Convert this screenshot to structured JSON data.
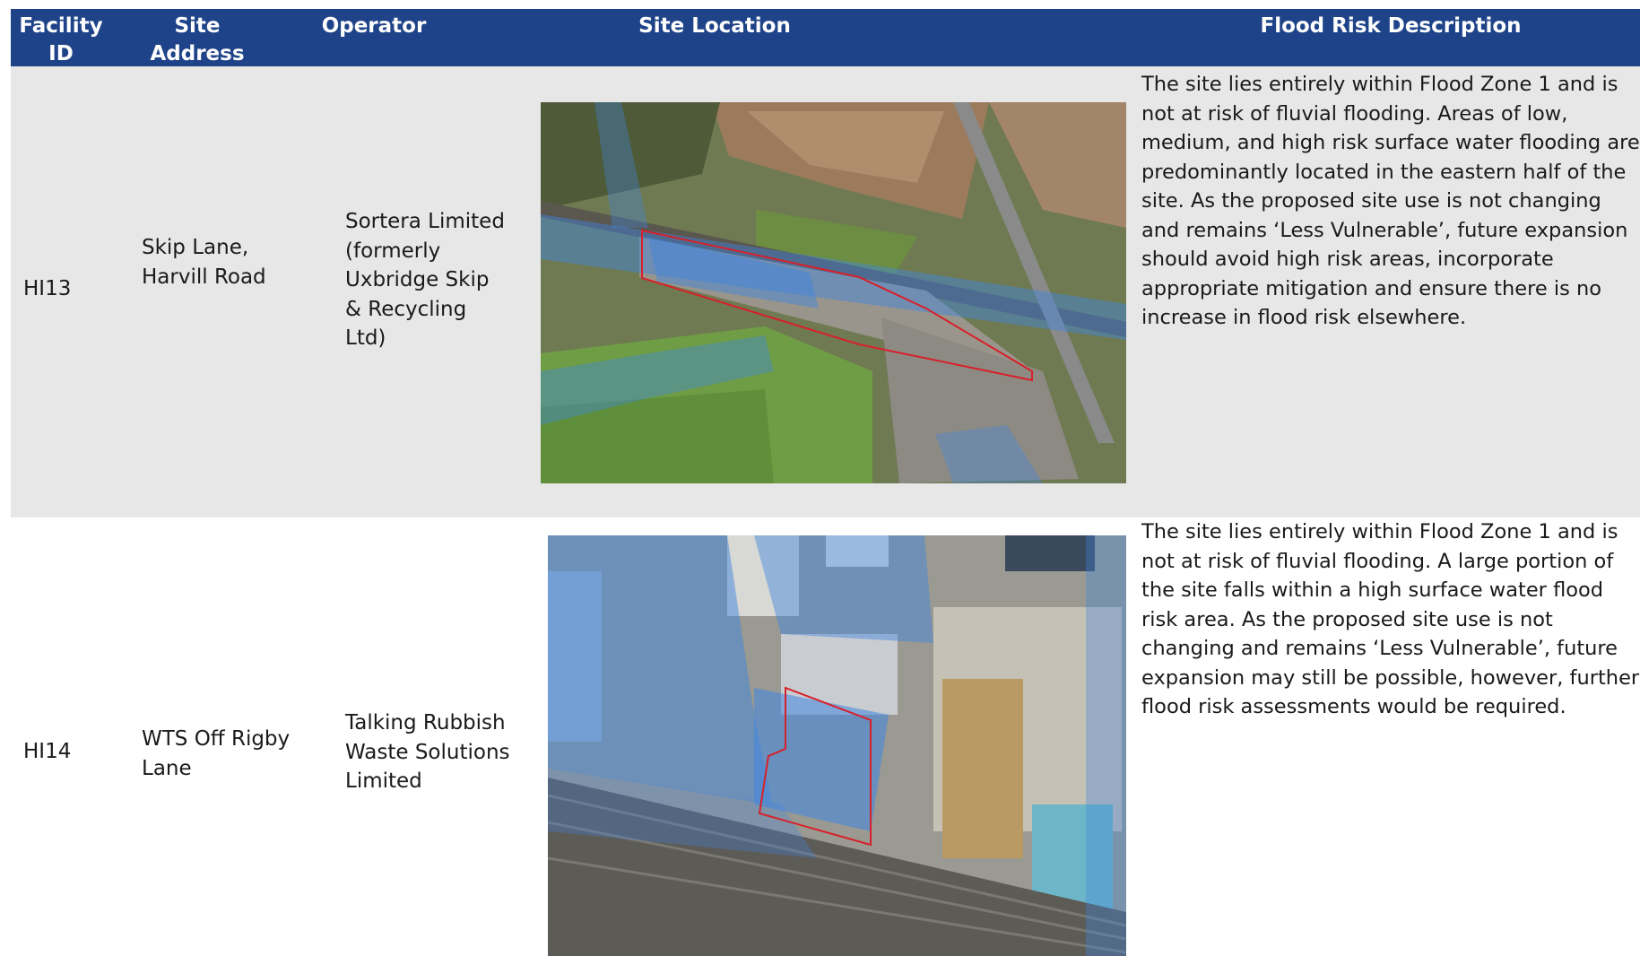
{
  "header": {
    "facility_id": "Facility ID",
    "site_address": "Site Address",
    "operator": "Operator",
    "site_location": "Site Location",
    "flood_risk": "Flood Risk Description"
  },
  "rows": [
    {
      "facility_id": "HI13",
      "site_address": "Skip Lane, Harvill Road",
      "operator": "Sortera Limited (formerly Uxbridge Skip & Recycling Ltd)",
      "description": "The site lies entirely within Flood Zone 1 and is not at risk of fluvial flooding. Areas of low, medium, and high risk surface water flooding are predominantly located in the eastern half of the site. As the proposed site use is not changing and remains ‘Less Vulnerable’, future expansion should avoid high risk areas, incorporate appropriate mitigation and ensure there is no increase in flood risk elsewhere."
    },
    {
      "facility_id": "HI14",
      "site_address": "WTS Off Rigby Lane",
      "operator": "Talking Rubbish Waste Solutions Limited",
      "description": "The site lies entirely within Flood Zone 1 and is not at risk of fluvial flooding. A large portion of the site falls within a high surface water flood risk area. As the proposed site use is not changing and remains ‘Less Vulnerable’, future expansion may still be possible, however, further flood risk assessments would be required."
    }
  ],
  "colors": {
    "header_bg": "#1f4389",
    "row_alt_bg": "#e7e7e7",
    "site_boundary": "#d8202a",
    "flood_overlay": "#3f86e0"
  }
}
